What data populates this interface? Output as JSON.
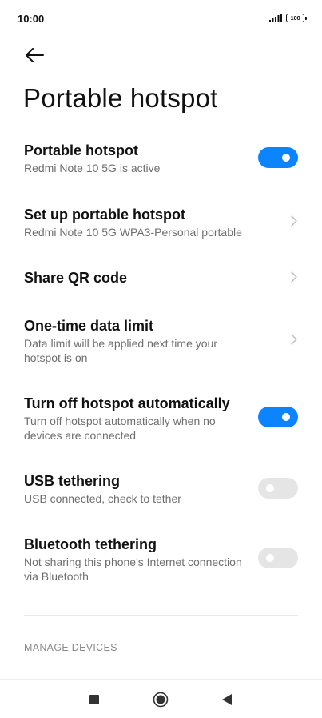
{
  "status_bar": {
    "time": "10:00",
    "battery_level": "100",
    "signal_icon": "signal-bars-icon",
    "battery_icon": "battery-icon"
  },
  "header": {
    "back_icon": "back-arrow-icon",
    "title": "Portable hotspot"
  },
  "settings": {
    "portable_hotspot": {
      "title": "Portable hotspot",
      "subtitle": "Redmi Note 10 5G is active",
      "enabled": true
    },
    "setup": {
      "title": "Set up portable hotspot",
      "subtitle": "Redmi Note 10 5G WPA3-Personal portable"
    },
    "share_qr": {
      "title": "Share QR code"
    },
    "data_limit": {
      "title": "One-time data limit",
      "subtitle": "Data limit will be applied next time your hotspot is on"
    },
    "auto_off": {
      "title": "Turn off hotspot automatically",
      "subtitle": "Turn off hotspot automatically when no devices are connected",
      "enabled": true
    },
    "usb_tethering": {
      "title": "USB tethering",
      "subtitle": "USB connected, check to tether",
      "enabled": false
    },
    "bluetooth_tethering": {
      "title": "Bluetooth tethering",
      "subtitle": "Not sharing this phone's Internet connection via Bluetooth",
      "enabled": false
    }
  },
  "section": {
    "manage_devices": "MANAGE DEVICES"
  },
  "colors": {
    "accent": "#0d84ff",
    "toggle_off": "#e5e5e5",
    "subtitle": "#6e6e6e"
  },
  "nav": {
    "recents_icon": "square-icon",
    "home_icon": "circle-icon",
    "back_icon": "triangle-back-icon"
  }
}
